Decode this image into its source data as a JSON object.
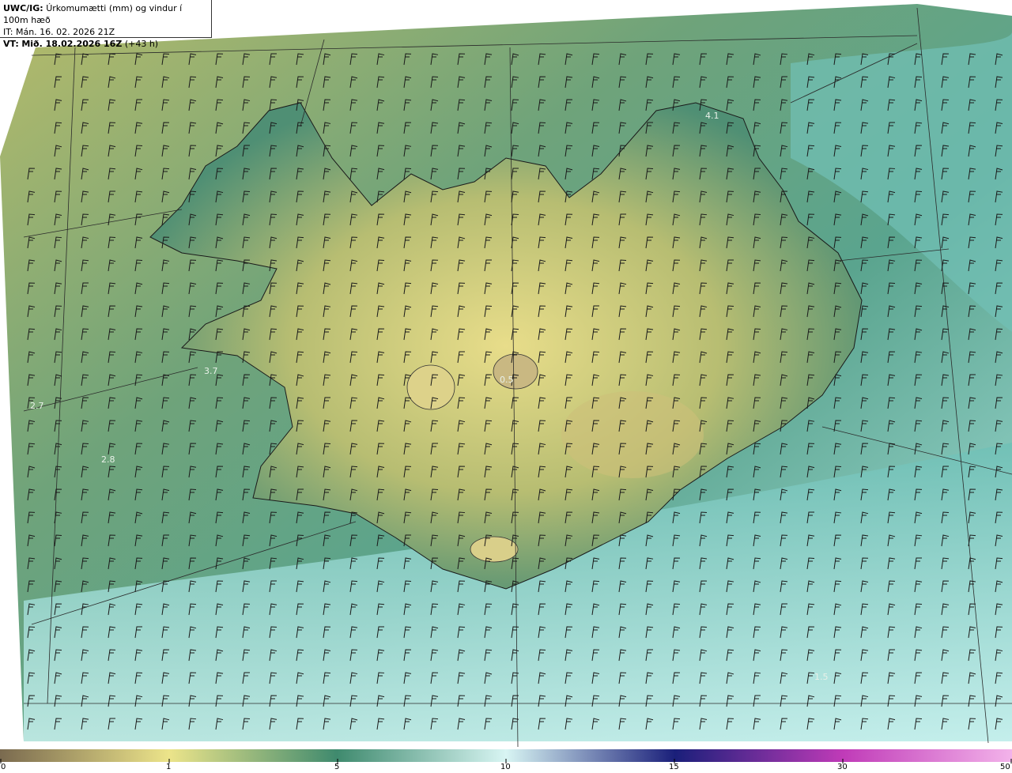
{
  "header": {
    "product_label": "UWC/IG:",
    "product_title": "Úrkomumætti (mm) og vindur í 100m hæð",
    "init_label": "IT:",
    "init_time": "Mán. 16. 02. 2026 21Z",
    "valid_label": "VT:",
    "valid_time_bold": "Mið. 18.02.2026 16Z",
    "valid_offset": "(+43 h)"
  },
  "map_labels": [
    "4.1",
    "3.7",
    "2.7",
    "2.8",
    "0.5",
    "1.5"
  ],
  "colorbar": {
    "ticks": [
      "0",
      "1",
      "5",
      "10",
      "15",
      "30",
      "50"
    ],
    "colors": {
      "brown": "#7a6a4f",
      "tan": "#d9c48a",
      "yellow": "#ece48a",
      "green": "#3f8a6e",
      "teal": "#7fcfc7",
      "pale": "#d8f5f3",
      "navy": "#1a1f7a",
      "magenta": "#c03bb8",
      "pink": "#f3b3ea"
    }
  }
}
